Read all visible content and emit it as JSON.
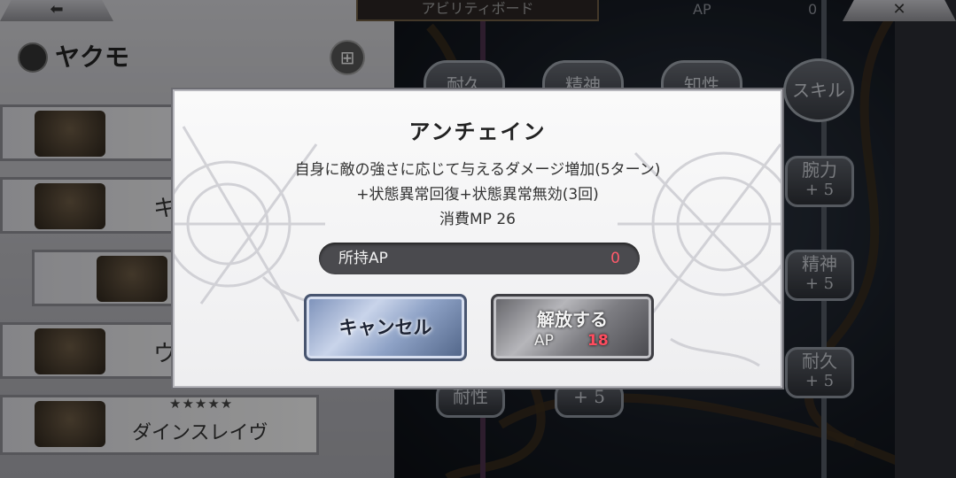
{
  "topbar": {
    "back_icon": "back-arrow-icon",
    "title": "アビリティボード",
    "ap_label": "AP",
    "ap_value": "0",
    "close_icon": "close-icon"
  },
  "character": {
    "name": "ヤクモ",
    "emblem_icon": "character-emblem-icon",
    "grid_icon": "board-grid-icon"
  },
  "weapons": {
    "rows": [
      {
        "label": ""
      },
      {
        "label": "キ"
      },
      {
        "label": ""
      },
      {
        "label": "ウ"
      },
      {
        "label": "ダインスレイヴ",
        "stars": "★★★★★"
      }
    ]
  },
  "board": {
    "top_nodes": [
      {
        "label": "耐久"
      },
      {
        "label": "精神"
      },
      {
        "label": "知性"
      },
      {
        "label": "スキル"
      }
    ],
    "side_nodes": [
      {
        "label": "腕力",
        "value": "+ 5"
      },
      {
        "label": "精神",
        "value": "+ 5"
      },
      {
        "label": "耐久",
        "value": "+ 5"
      }
    ],
    "bottom_nodes": [
      {
        "label": "耐性"
      },
      {
        "label": "+ 5"
      }
    ]
  },
  "dialog": {
    "title": "アンチェイン",
    "description_lines": [
      "自身に敵の強さに応じて与えるダメージ増加(5ターン)",
      "+状態異常回復+状態異常無効(3回)",
      "消費MP 26"
    ],
    "owned_ap_label": "所持AP",
    "owned_ap_value": "0",
    "cancel_label": "キャンセル",
    "release_label": "解放する",
    "release_ap_label": "AP",
    "release_ap_value": "18"
  },
  "colors": {
    "ap_highlight": "#ff5a6b",
    "dialog_bg": "#f4f4f6",
    "cancel_blue": "#8ea2c6"
  }
}
